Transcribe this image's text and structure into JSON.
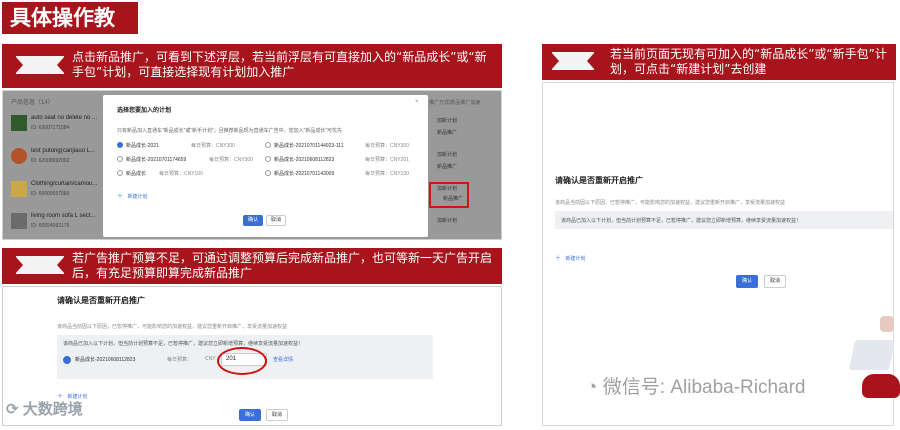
{
  "page_title": "具体操作教程：",
  "banner1": {
    "text": "点击新品推广，可看到下述浮层，若当前浮层有可直接加入的“新品成长”或“新手包”计划，可直接选择现有计划加入推广"
  },
  "banner2": {
    "text": "若当前页面无现有可加入的“新品成长”或“新手包”计划，可点击“新建计划”去创建"
  },
  "banner3": {
    "text": "若广告推广预算不足，可通过调整预算后完成新品推广，也可等新一天广告开启后，有充足预算即算完成新品推广"
  },
  "shot1": {
    "header_left": "产品信息（14）",
    "header_right": "推广方式/新品推广加速",
    "products": [
      {
        "name": "auto seat no delete no ...",
        "id": "ID: 62007171584"
      },
      {
        "name": "test putong(canjiauo L...",
        "id": "ID: 62008992002"
      },
      {
        "name": "Clothing/curtain/camou...",
        "id": "ID: 60000057080"
      },
      {
        "name": "living room sofa L sect...",
        "id": "ID: 60054092179"
      }
    ],
    "side_labels": [
      "加新计划",
      "新品推广",
      "加新计划",
      "新品推广",
      "加新计划",
      "新品推广",
      "加新计划"
    ],
    "modal": {
      "title": "选择您要加入的计划",
      "desc": "只有新品加入直通车“新品成长”或“新手计划”；且推荐新品现为直通车广告中。您加入“新品成长”可优先",
      "plans": [
        {
          "name": "新品成长-2021",
          "budget": "每日预算：CNY300"
        },
        {
          "name": "新品成长-20210701144923-111",
          "budget": "每日预算：CNY300"
        },
        {
          "name": "新品成长-20210701174659",
          "budget": "每日预算：CNY300"
        },
        {
          "name": "新品成长-20210608112823",
          "budget": "每日预算：CNY201"
        },
        {
          "name": "新品成长",
          "budget": "每日预算：CNY100"
        },
        {
          "name": "新品成长-20210701143009",
          "budget": "每日预算：CNY100"
        }
      ],
      "new_plan": "新建计划",
      "confirm": "确认",
      "cancel": "取消",
      "close": "×"
    }
  },
  "shot2": {
    "title": "请确认是否重新开启推广",
    "desc": "该商品当前因以下原因，已暂停推广，可能影响您的加速权益，建议您重新开启推广，享受流量加速权益",
    "notice": "该商品已加入以下计划，但当前计划预算不足，已暂停推广，建议您立即新增预算，继续享受流量加速权益！",
    "new_plan": "新建计划",
    "confirm": "确认",
    "cancel": "取消"
  },
  "shot3": {
    "title": "请确认是否重新开启推广",
    "desc": "该商品当前因以下原因，已暂停推广，可能影响您的加速权益，建议您重新开启推广，享受流量加速权益",
    "notice": "该商品已加入以下计划，但当前计划预算不足，已暂停推广，建议您立即新增预算，继续享受流量加速权益！",
    "plan_name": "新品成长-20210608112823",
    "budget_label": "每日预算：",
    "budget_prefix": "CNY",
    "budget_value": "201",
    "view_link": "查看详情",
    "new_plan": "新建计划",
    "confirm": "确认",
    "cancel": "取消"
  },
  "watermarks": {
    "wechat": "微信号: Alibaba-Richard",
    "logo": "大数跨境"
  },
  "colors": {
    "brand_red": "#a8141c",
    "accent_blue": "#3a6fd8",
    "highlight_red": "#d01414"
  }
}
